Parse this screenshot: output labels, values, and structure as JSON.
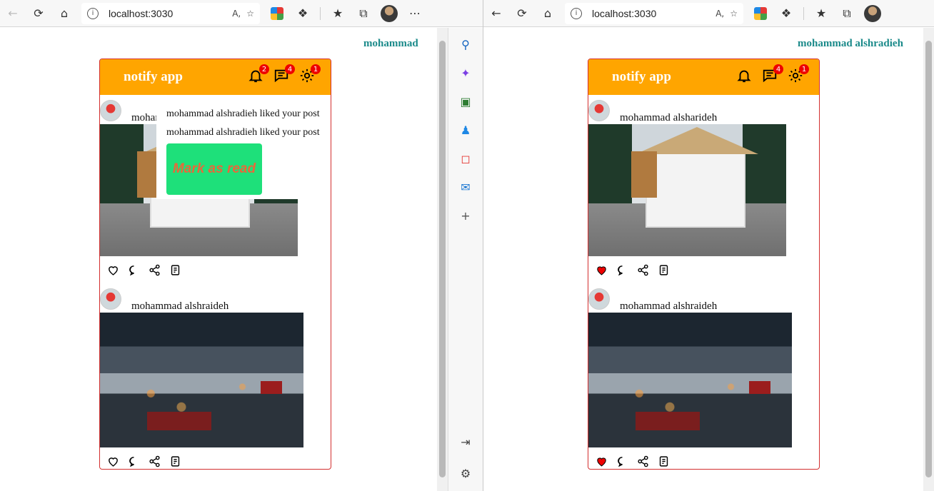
{
  "browser": {
    "url": "localhost:3030",
    "read_aloud_icon": "A̩"
  },
  "left_window": {
    "username": "mohammad",
    "app_title": "notify app",
    "badges": {
      "notifications": "2",
      "messages": "4",
      "settings": "1"
    },
    "posts": [
      {
        "author": "mohammad alsharideh",
        "image": "house",
        "liked": false
      },
      {
        "author": "mohammad alshraideh",
        "image": "village",
        "liked": false
      }
    ],
    "dropdown": {
      "items": [
        "mohammad alshradieh liked your post",
        "mohammad alshradieh liked your post"
      ],
      "mark_as_read": "Mark as read"
    }
  },
  "right_window": {
    "username": "mohammad alshradieh",
    "app_title": "notify app",
    "badges": {
      "messages": "4",
      "settings": "1"
    },
    "posts": [
      {
        "author": "mohammad alsharideh",
        "image": "house",
        "liked": true
      },
      {
        "author": "mohammad alshraideh",
        "image": "village",
        "liked": true
      }
    ]
  },
  "colors": {
    "header": "#ffa500",
    "username": "#1b8a8a",
    "badge": "#ee0000",
    "border": "#d32f2f",
    "mark_button": "#1ee07a",
    "mark_text": "#e8683a",
    "like": "#e00000"
  }
}
